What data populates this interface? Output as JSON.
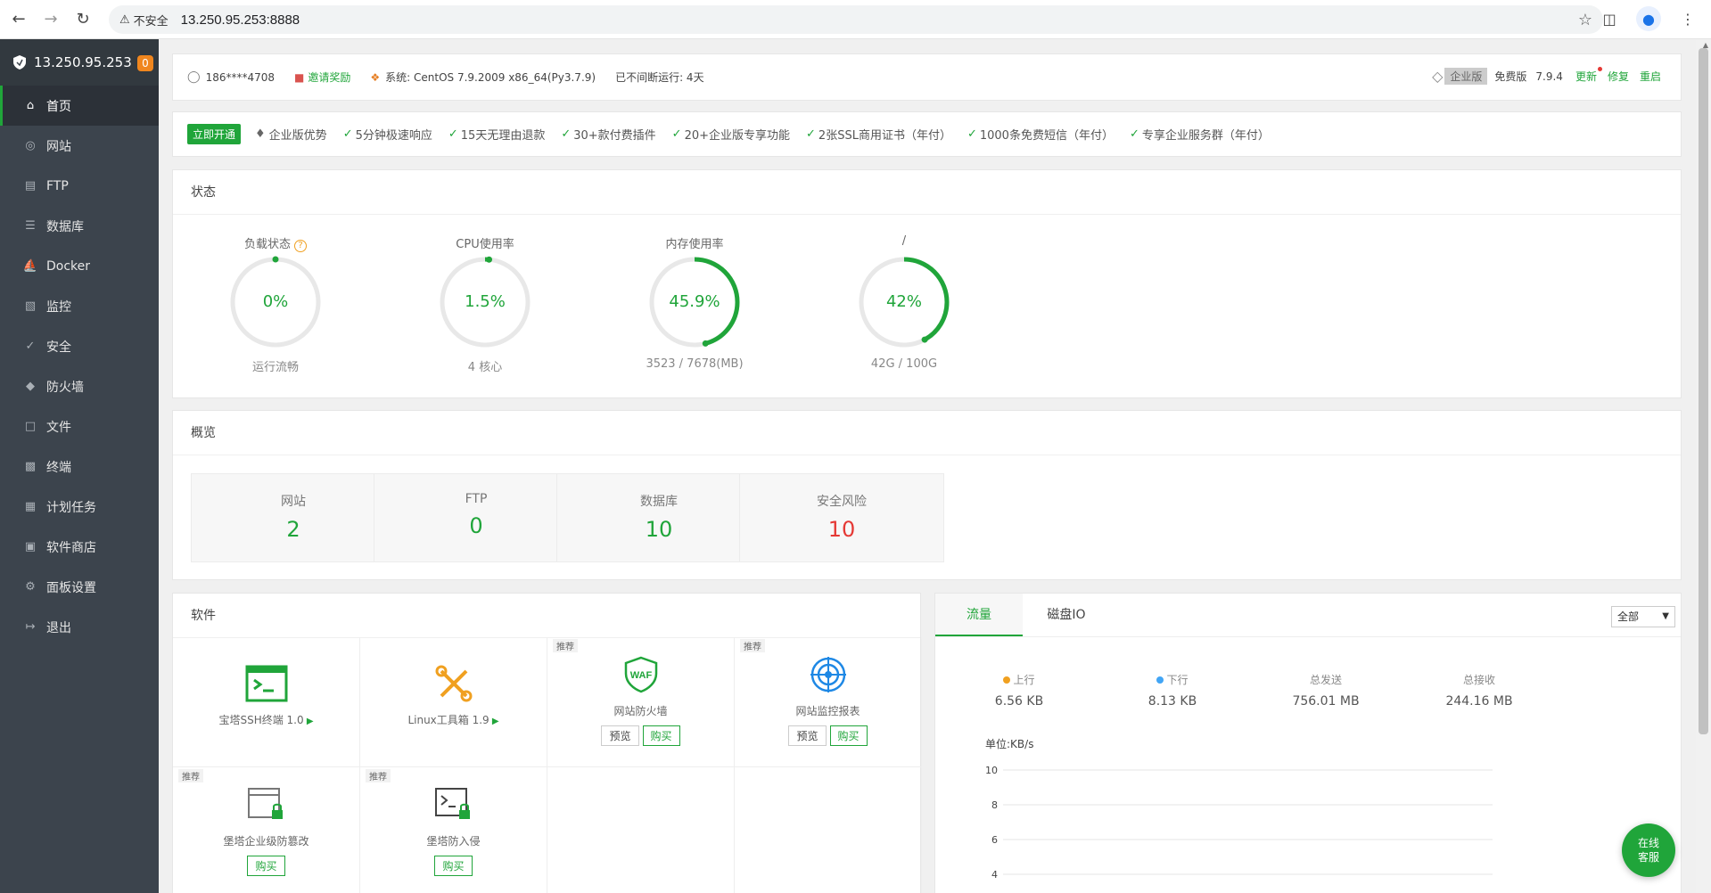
{
  "browser": {
    "insecure_label": "不安全",
    "url": "13.250.95.253:8888"
  },
  "sidebar": {
    "host": "13.250.95.253",
    "badge": "0",
    "items": [
      {
        "label": "首页",
        "icon": "home-icon"
      },
      {
        "label": "网站",
        "icon": "globe-icon"
      },
      {
        "label": "FTP",
        "icon": "ftp-icon"
      },
      {
        "label": "数据库",
        "icon": "database-icon"
      },
      {
        "label": "Docker",
        "icon": "docker-icon"
      },
      {
        "label": "监控",
        "icon": "monitor-icon"
      },
      {
        "label": "安全",
        "icon": "shield-check-icon"
      },
      {
        "label": "防火墙",
        "icon": "firewall-icon"
      },
      {
        "label": "文件",
        "icon": "folder-icon"
      },
      {
        "label": "终端",
        "icon": "terminal-icon"
      },
      {
        "label": "计划任务",
        "icon": "calendar-icon"
      },
      {
        "label": "软件商店",
        "icon": "apps-icon"
      },
      {
        "label": "面板设置",
        "icon": "settings-icon"
      },
      {
        "label": "退出",
        "icon": "logout-icon"
      }
    ]
  },
  "topinfo": {
    "user": "186****4708",
    "invite": "邀请奖励",
    "system": "系统:  CentOS 7.9.2009 x86_64(Py3.7.9)",
    "uptime": "已不间断运行: 4天",
    "enterprise": "企业版",
    "free": "免费版",
    "version": "7.9.4",
    "update": "更新",
    "repair": "修复",
    "restart": "重启"
  },
  "promo": {
    "open": "立即开通",
    "advantage": "企业版优势",
    "items": [
      "5分钟极速响应",
      "15天无理由退款",
      "30+款付费插件",
      "20+企业版专享功能",
      "2张SSL商用证书（年付）",
      "1000条免费短信（年付）",
      "专享企业服务群（年付）"
    ]
  },
  "status": {
    "title": "状态",
    "gauges": [
      {
        "title": "负载状态",
        "value": "0%",
        "pct": 0,
        "sub": "运行流畅"
      },
      {
        "title": "CPU使用率",
        "value": "1.5%",
        "pct": 1.5,
        "sub": "4 核心"
      },
      {
        "title": "内存使用率",
        "value": "45.9%",
        "pct": 45.9,
        "sub": "3523 / 7678(MB)"
      },
      {
        "title": "/",
        "value": "42%",
        "pct": 42,
        "sub": "42G / 100G"
      }
    ]
  },
  "overview": {
    "title": "概览",
    "cards": [
      {
        "label": "网站",
        "value": "2"
      },
      {
        "label": "FTP",
        "value": "0"
      },
      {
        "label": "数据库",
        "value": "10"
      },
      {
        "label": "安全风险",
        "value": "10"
      }
    ]
  },
  "software": {
    "title": "软件",
    "recommend": "推荐",
    "preview": "预览",
    "buy": "购买",
    "items": [
      {
        "name": "宝塔SSH终端 1.0"
      },
      {
        "name": "Linux工具箱 1.9"
      },
      {
        "name": "网站防火墙"
      },
      {
        "name": "网站监控报表"
      },
      {
        "name": "堡塔企业级防篡改"
      },
      {
        "name": "堡塔防入侵"
      }
    ]
  },
  "traffic": {
    "tabs": [
      "流量",
      "磁盘IO"
    ],
    "select": "全部",
    "stats": [
      {
        "label": "上行",
        "value": "6.56 KB"
      },
      {
        "label": "下行",
        "value": "8.13 KB"
      },
      {
        "label": "总发送",
        "value": "756.01 MB"
      },
      {
        "label": "总接收",
        "value": "244.16 MB"
      }
    ],
    "unit": "单位:KB/s",
    "yticks": [
      "10",
      "8",
      "6",
      "4"
    ]
  },
  "online_service": {
    "line1": "在线",
    "line2": "客服"
  },
  "colors": {
    "accent": "#20a53a",
    "danger": "#e53935",
    "sidebar": "#3c444d"
  }
}
